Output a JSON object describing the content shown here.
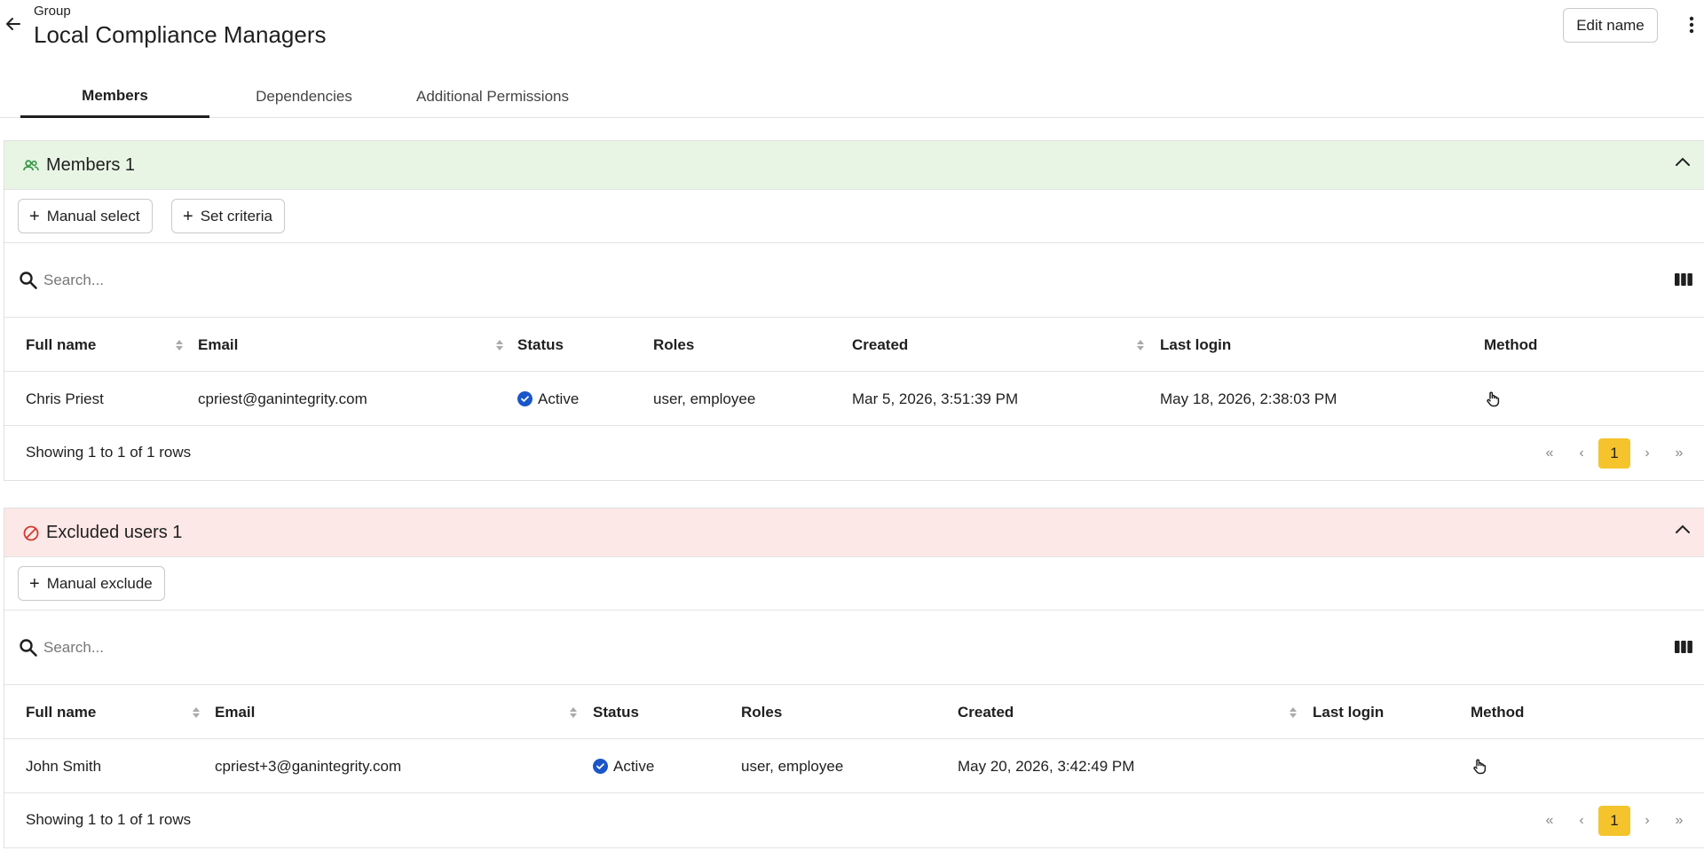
{
  "header": {
    "group_label": "Group",
    "title": "Local Compliance Managers",
    "edit_label": "Edit name"
  },
  "tabs": [
    {
      "label": "Members",
      "active": true
    },
    {
      "label": "Dependencies",
      "active": false
    },
    {
      "label": "Additional Permissions",
      "active": false
    }
  ],
  "members": {
    "title": "Members 1",
    "header_color": "#e8f5e4",
    "buttons": {
      "manual_select": "Manual select",
      "set_criteria": "Set criteria"
    },
    "search_placeholder": "Search...",
    "columns": [
      "Full name",
      "Email",
      "Status",
      "Roles",
      "Created",
      "Last login",
      "Method"
    ],
    "rows": [
      {
        "full_name": "Chris Priest",
        "email": "cpriest@ganintegrity.com",
        "status": "Active",
        "roles": "user, employee",
        "created": "Mar 5, 2026, 3:51:39 PM",
        "last_login": "May 18, 2026, 2:38:03 PM",
        "method_icon": "hand-pointer-icon"
      }
    ],
    "footer": "Showing 1 to 1 of 1 rows",
    "page": "1"
  },
  "excluded": {
    "title": "Excluded users 1",
    "header_color": "#fce8e6",
    "buttons": {
      "manual_exclude": "Manual exclude"
    },
    "search_placeholder": "Search...",
    "columns": [
      "Full name",
      "Email",
      "Status",
      "Roles",
      "Created",
      "Last login",
      "Method"
    ],
    "rows": [
      {
        "full_name": "John Smith",
        "email": "cpriest+3@ganintegrity.com",
        "status": "Active",
        "roles": "user, employee",
        "created": "May 20, 2026, 3:42:49 PM",
        "last_login": "",
        "method_icon": "hand-pointer-icon"
      }
    ],
    "footer": "Showing 1 to 1 of 1 rows",
    "page": "1"
  },
  "colors": {
    "accent_page": "#f5c42c",
    "status_active": "#1a56c8",
    "members_icon": "#3a9a4a",
    "excluded_icon": "#d23b2f"
  }
}
